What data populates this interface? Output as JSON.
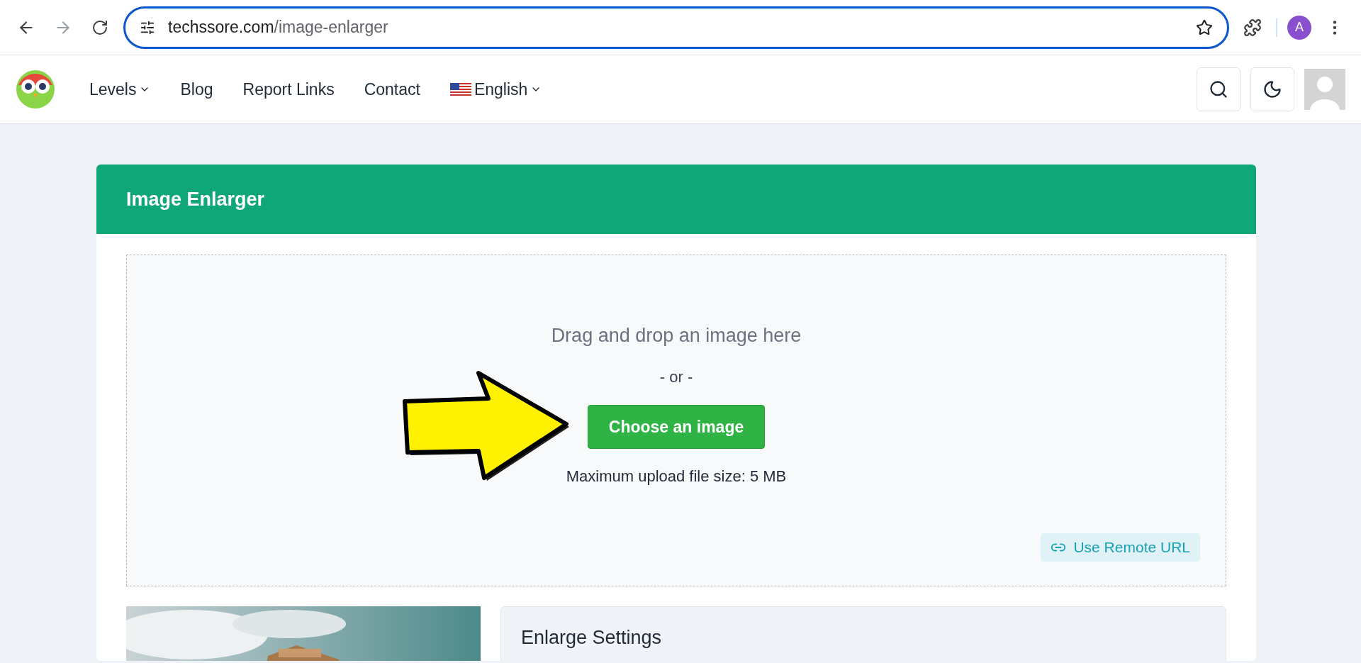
{
  "browser": {
    "url_host": "techssore.com",
    "url_path": "/image-enlarger",
    "profile_initial": "A"
  },
  "nav": {
    "items": [
      {
        "label": "Levels",
        "dropdown": true
      },
      {
        "label": "Blog",
        "dropdown": false
      },
      {
        "label": "Report Links",
        "dropdown": false
      },
      {
        "label": "Contact",
        "dropdown": false
      }
    ],
    "language": "English"
  },
  "card": {
    "title": "Image Enlarger",
    "dropzone": {
      "prompt": "Drag and drop an image here",
      "separator": "- or -",
      "button": "Choose an image",
      "limit": "Maximum upload file size: 5 MB",
      "remote_url": "Use Remote URL"
    }
  },
  "settings": {
    "title": "Enlarge Settings"
  }
}
